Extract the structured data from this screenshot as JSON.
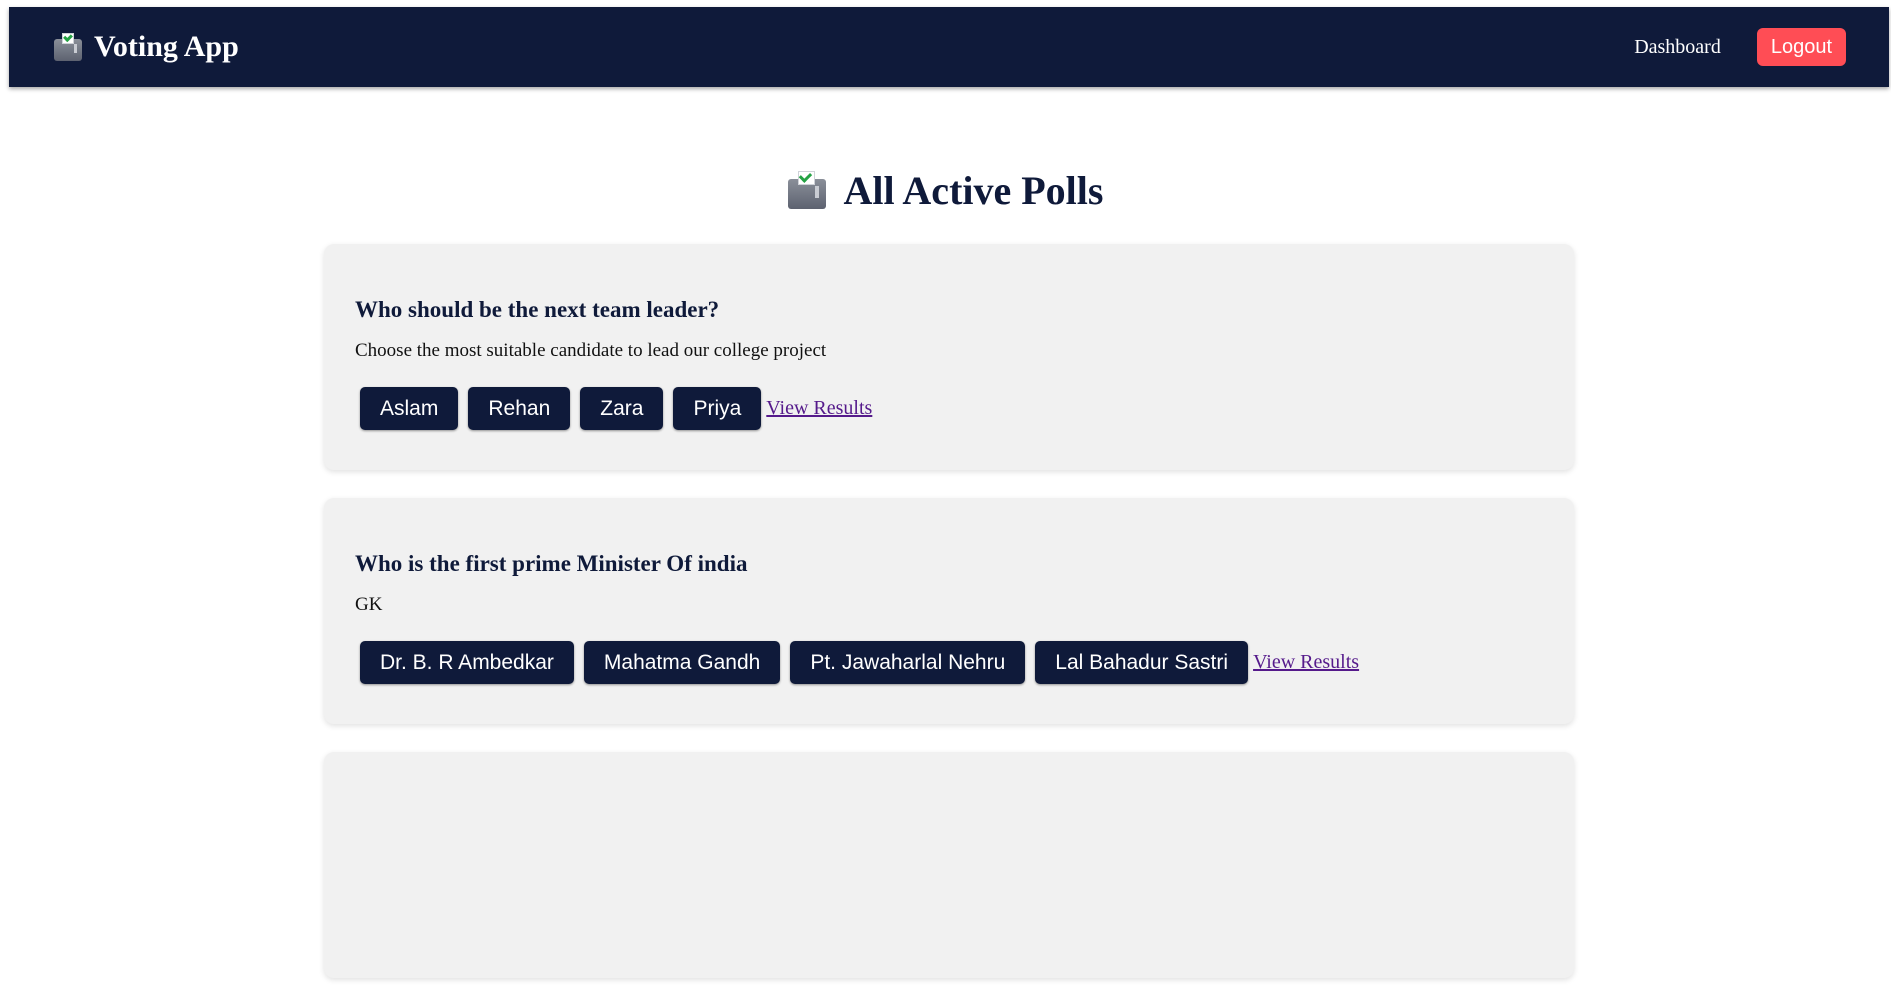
{
  "navbar": {
    "brand_title": "Voting App",
    "brand_icon": "ballot-box-icon",
    "dashboard_link": "Dashboard",
    "logout_label": "Logout"
  },
  "main": {
    "title": "All Active Polls",
    "title_icon": "ballot-box-icon"
  },
  "polls": [
    {
      "question": "Who should be the next team leader?",
      "description": "Choose the most suitable candidate to lead our college project",
      "options": [
        "Aslam",
        "Rehan",
        "Zara",
        "Priya"
      ],
      "results_link": "View Results"
    },
    {
      "question": "Who is the first prime Minister Of india",
      "description": "GK",
      "options": [
        "Dr. B. R Ambedkar",
        "Mahatma Gandh",
        "Pt. Jawaharlal Nehru",
        "Lal Bahadur Sastri"
      ],
      "results_link": "View Results"
    },
    {
      "question": "",
      "description": "",
      "options": [],
      "results_link": ""
    }
  ],
  "colors": {
    "navbar_bg": "#0f1a3a",
    "logout_bg": "#ff4d55",
    "card_bg": "#f1f1f1",
    "option_bg": "#0f1a3a",
    "link_color": "#551a8b"
  }
}
